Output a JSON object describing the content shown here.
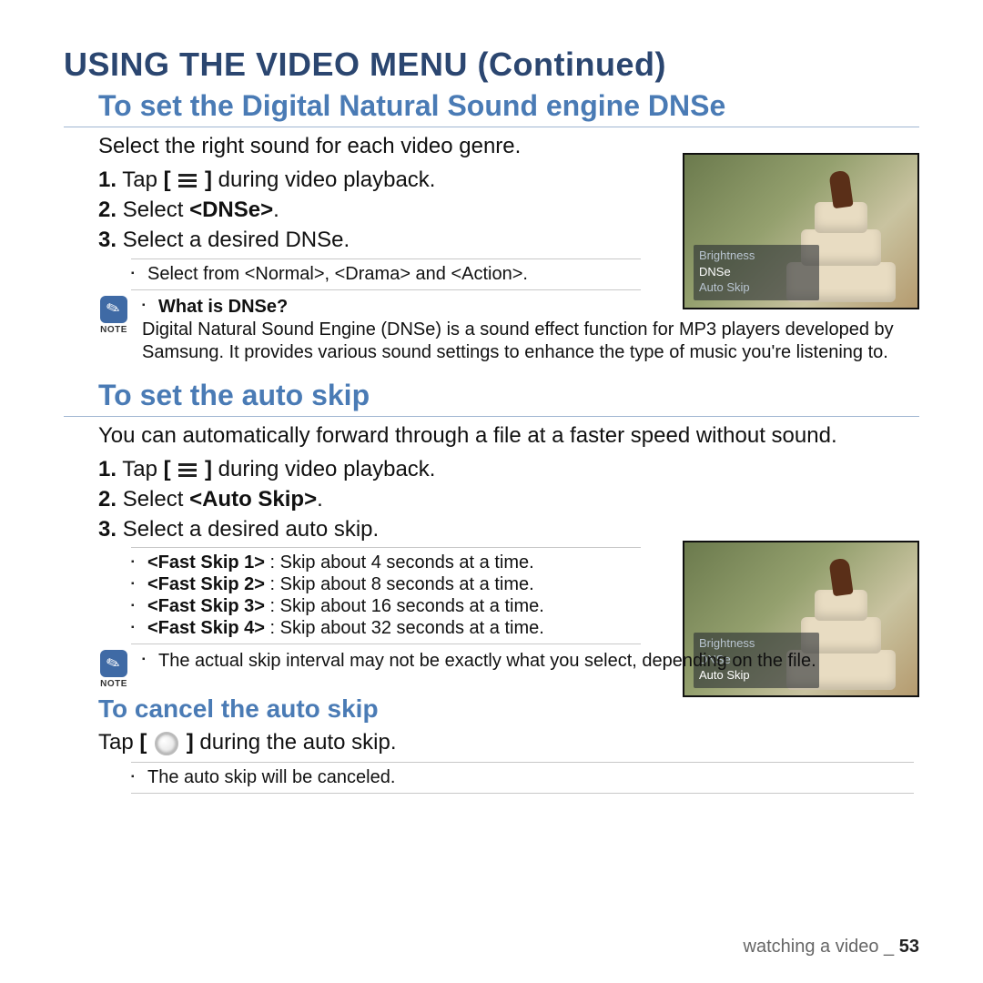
{
  "page_title": "USING THE VIDEO MENU (Continued)",
  "section1": {
    "heading": "To set the Digital Natural Sound engine DNSe",
    "intro": "Select the right sound for each video genre.",
    "step1_pre": "Tap ",
    "step1_open": "[ ",
    "step1_close": " ]",
    "step1_post": " during video playback.",
    "step2_pre": "Select ",
    "step2_bold": "<DNSe>",
    "step2_post": ".",
    "step3": "Select a desired DNSe.",
    "sub1": "Select from <Normal>, <Drama> and <Action>.",
    "menu_items": [
      "Brightness",
      "DNSe",
      "Auto Skip"
    ],
    "menu_highlight": 1
  },
  "note1": {
    "label": "NOTE",
    "title": "What is DNSe?",
    "text": "Digital Natural Sound Engine (DNSe) is a sound effect function for MP3 players developed by Samsung. It provides various sound settings to enhance the type of music you're listening to."
  },
  "section2": {
    "heading": "To set the auto skip",
    "intro": "You can automatically forward through a file at a faster speed without sound.",
    "step1_pre": "Tap ",
    "step1_open": "[ ",
    "step1_close": " ]",
    "step1_post": " during video playback.",
    "step2_pre": "Select ",
    "step2_bold": "<Auto Skip>",
    "step2_post": ".",
    "step3": "Select a desired auto skip.",
    "subs": [
      {
        "b": "<Fast Skip 1>",
        "t": " : Skip about 4 seconds at a time."
      },
      {
        "b": "<Fast Skip 2>",
        "t": " : Skip about 8 seconds at a time."
      },
      {
        "b": "<Fast Skip 3>",
        "t": " : Skip about 16 seconds at a time."
      },
      {
        "b": "<Fast Skip 4>",
        "t": " : Skip about 32 seconds at a time."
      }
    ],
    "menu_items": [
      "Brightness",
      "DNSe",
      "Auto Skip"
    ],
    "menu_highlight": 2
  },
  "note2": {
    "label": "NOTE",
    "text": "The actual skip interval may not be exactly what you select, depending on the file."
  },
  "section3": {
    "heading": "To cancel the auto skip",
    "body_pre": "Tap ",
    "body_open": "[ ",
    "body_close": " ]",
    "body_post": " during the auto skip.",
    "sub1": "The auto skip will be canceled."
  },
  "footer": {
    "section": "watching a video _ ",
    "page": "53"
  }
}
